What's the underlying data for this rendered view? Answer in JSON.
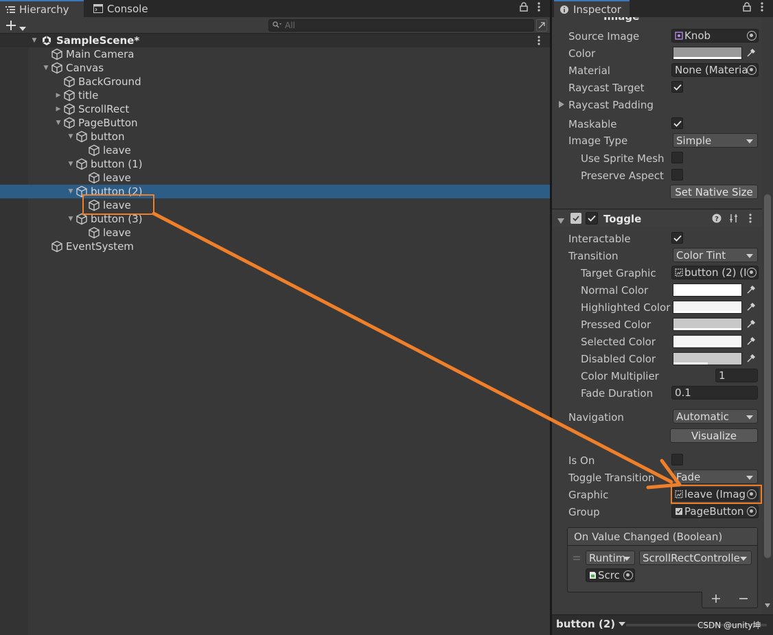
{
  "hierarchy": {
    "tab_title": "Hierarchy",
    "console_tab": "Console",
    "search_placeholder": "All",
    "scene": "SampleScene*",
    "items": [
      {
        "label": "Main Camera"
      },
      {
        "label": "Canvas"
      },
      {
        "label": "BackGround"
      },
      {
        "label": "title"
      },
      {
        "label": "ScrollRect"
      },
      {
        "label": "PageButton"
      },
      {
        "label": "button"
      },
      {
        "label": "leave"
      },
      {
        "label": "button (1)"
      },
      {
        "label": "leave"
      },
      {
        "label": "button (2)"
      },
      {
        "label": "leave"
      },
      {
        "label": "button (3)"
      },
      {
        "label": "leave"
      },
      {
        "label": "EventSystem"
      }
    ]
  },
  "inspector": {
    "tab_title": "Inspector",
    "image_component": {
      "name": "Image",
      "source_image_label": "Source Image",
      "source_image": "Knob",
      "color_label": "Color",
      "material_label": "Material",
      "material": "None (Materia",
      "raycast_target_label": "Raycast Target",
      "raycast_padding_label": "Raycast Padding",
      "maskable_label": "Maskable",
      "image_type_label": "Image Type",
      "image_type": "Simple",
      "use_sprite_mesh_label": "Use Sprite Mesh",
      "preserve_aspect_label": "Preserve Aspect",
      "set_native_size": "Set Native Size"
    },
    "toggle_component": {
      "name": "Toggle",
      "interactable_label": "Interactable",
      "transition_label": "Transition",
      "transition": "Color Tint",
      "target_graphic_label": "Target Graphic",
      "target_graphic": "button (2) (I",
      "normal_color_label": "Normal Color",
      "highlighted_color_label": "Highlighted Color",
      "pressed_color_label": "Pressed Color",
      "selected_color_label": "Selected Color",
      "disabled_color_label": "Disabled Color",
      "color_multiplier_label": "Color Multiplier",
      "color_multiplier": "1",
      "fade_duration_label": "Fade Duration",
      "fade_duration": "0.1",
      "navigation_label": "Navigation",
      "navigation": "Automatic",
      "visualize": "Visualize",
      "is_on_label": "Is On",
      "toggle_transition_label": "Toggle Transition",
      "toggle_transition": "Fade",
      "graphic_label": "Graphic",
      "graphic": "leave (Imag",
      "group_label": "Group",
      "group": "PageButton"
    },
    "event": {
      "title": "On Value Changed (Boolean)",
      "runtime": "Runtim",
      "function": "ScrollRectControlle",
      "object": "Scrc"
    },
    "footer": {
      "object_name": "button (2)",
      "watermark": "CSDN @unity坤"
    }
  },
  "colors": {
    "selection": "#2c5d87",
    "annotation": "#f07f2a",
    "source_color": "#9a9a9a",
    "normal_color": "#ffffff",
    "highlighted_color": "#f5f5f5",
    "pressed_color": "#c8c8c8",
    "selected_color": "#f5f5f5",
    "disabled_color": "#c8c8c8"
  }
}
